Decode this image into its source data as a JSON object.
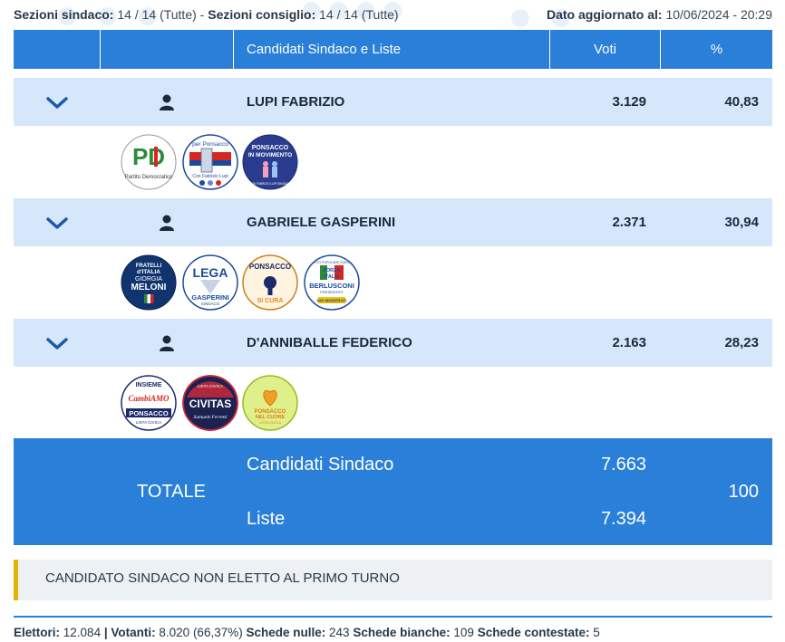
{
  "topbar": {
    "sez_sindaco_label": "Sezioni sindaco:",
    "sez_sindaco_value": "14 / 14 (Tutte)",
    "sep": "-",
    "sez_consiglio_label": "Sezioni consiglio:",
    "sez_consiglio_value": "14 / 14 (Tutte)",
    "updated_label": "Dato aggiornato al:",
    "updated_value": "10/06/2024 - 20:29"
  },
  "table": {
    "headers": [
      "",
      "",
      "Candidati Sindaco e Liste",
      "Voti",
      "%"
    ]
  },
  "candidates": [
    {
      "name": "LUPI FABRIZIO",
      "votes": "3.129",
      "percent": "40,83",
      "lists": [
        {
          "icon": "pd-logo",
          "text": [
            "PD",
            "Partito Democratico"
          ]
        },
        {
          "icon": "per-ponsacco-logo",
          "text": [
            "per Ponsacco",
            "Con Fabrizio Lupi"
          ]
        },
        {
          "icon": "ponsacco-in-movimento-logo",
          "text": [
            "PONSACCO",
            "IN MOVIMENTO",
            "CON FABRIZIO LUPI SINDACO"
          ]
        }
      ]
    },
    {
      "name": "GABRIELE GASPERINI",
      "votes": "2.371",
      "percent": "30,94",
      "lists": [
        {
          "icon": "fratelli-italia-logo",
          "text": [
            "FRATELLI",
            "d'ITALIA",
            "GIORGIA",
            "MELONI"
          ]
        },
        {
          "icon": "lega-logo",
          "text": [
            "LEGA",
            "GASPERINI",
            "SINDACO"
          ]
        },
        {
          "icon": "ponsacco-si-cura-logo",
          "text": [
            "PONSACCO",
            "SI CURA"
          ]
        },
        {
          "icon": "forza-italia-logo",
          "text": [
            "PARTITO POPOLARE EUROPEO",
            "FORZA",
            "ITALIA",
            "BERLUSCONI",
            "PRESIDENTE",
            "NOI MODERATI"
          ]
        }
      ]
    },
    {
      "name": "D'ANNIBALLE FEDERICO",
      "votes": "2.163",
      "percent": "28,23",
      "lists": [
        {
          "icon": "insieme-cambiamo-logo",
          "text": [
            "INSIEME",
            "CambiAMO",
            "PONSACCO",
            "LISTA CIVICA"
          ]
        },
        {
          "icon": "civitas-logo",
          "text": [
            "LISTA CIVICA",
            "CIVITAS",
            "Samuele Ferretti"
          ]
        },
        {
          "icon": "ponsacco-nel-cuore-logo",
          "text": [
            "PONSACCO",
            "NEL CUORE",
            "LISTA CIVICA"
          ]
        }
      ]
    }
  ],
  "totals": {
    "label": "TOTALE",
    "candidati_label": "Candidati Sindaco",
    "candidati_value": "7.663",
    "liste_label": "Liste",
    "liste_value": "7.394",
    "percent": "100"
  },
  "notice": "CANDIDATO SINDACO NON ELETTO AL PRIMO TURNO",
  "footer": {
    "elettori_label": "Elettori:",
    "elettori_value": "12.084",
    "votanti_label": "Votanti:",
    "votanti_value": "8.020 (66,37%)",
    "nulle_label": "Schede nulle:",
    "nulle_value": "243",
    "bianche_label": "Schede bianche:",
    "bianche_value": "109",
    "contestate_label": "Schede contestate:",
    "contestate_value": "5"
  },
  "colors": {
    "header_blue": "#2a7fd8",
    "candidate_row": "#d6e7fc",
    "notice_border": "#e0b400",
    "notice_bg": "#eef1f4"
  }
}
